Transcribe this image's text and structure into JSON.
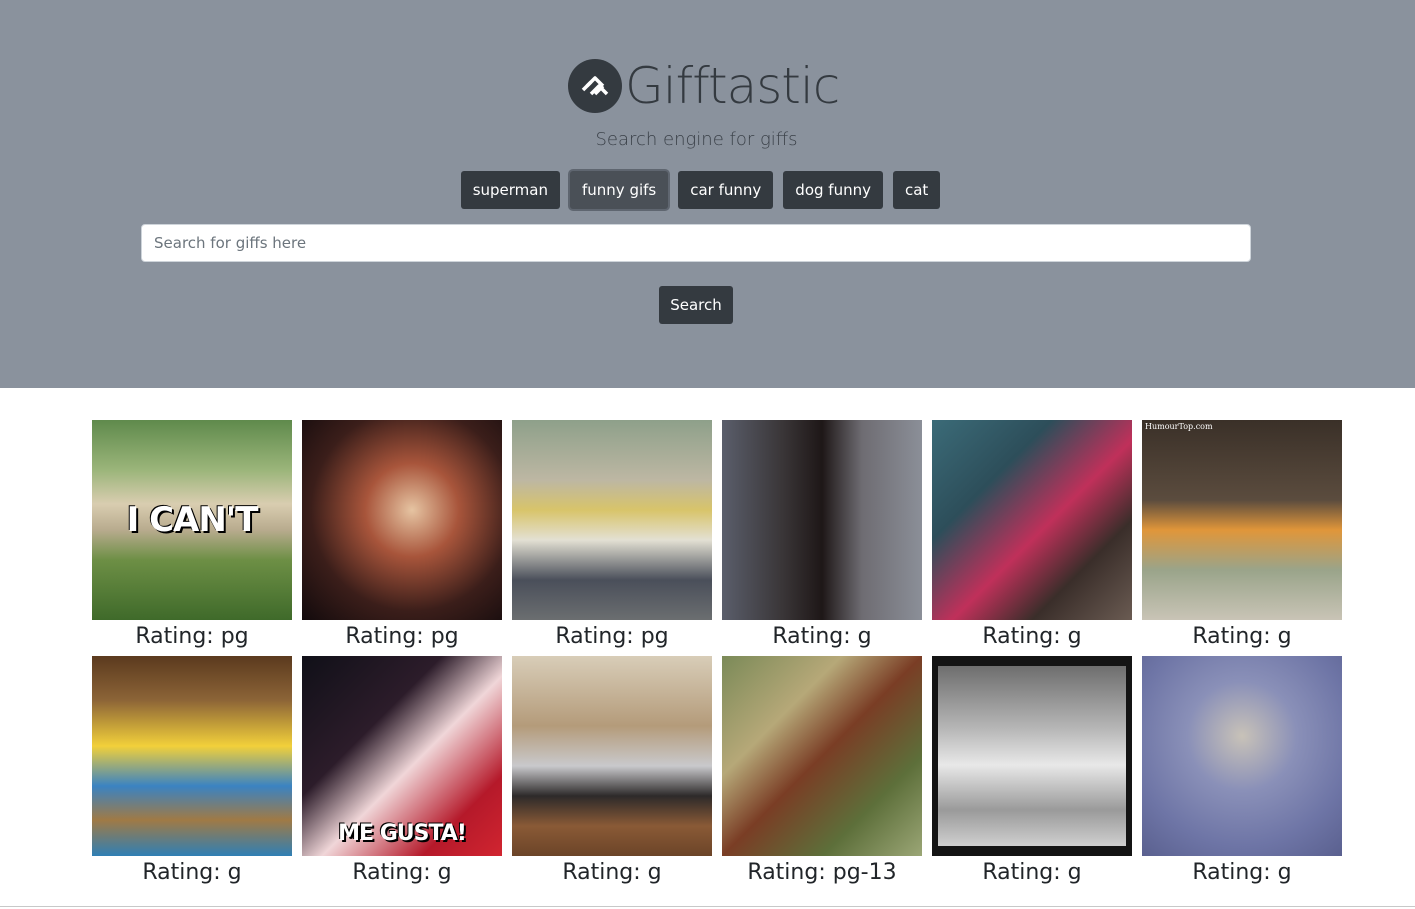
{
  "header": {
    "title": "Gifftastic",
    "tagline": "Search engine for giffs",
    "logo_icon": "gifftastic-logo-icon"
  },
  "topics": [
    {
      "label": "superman",
      "active": false
    },
    {
      "label": "funny gifs",
      "active": true
    },
    {
      "label": "car funny",
      "active": false
    },
    {
      "label": "dog funny",
      "active": false
    },
    {
      "label": "cat",
      "active": false
    }
  ],
  "search": {
    "placeholder": "Search for giffs here",
    "value": "",
    "button_label": "Search"
  },
  "gifs": [
    {
      "rating": "Rating: pg",
      "caption": "I CAN'T",
      "caption_style": "large",
      "watermark": ""
    },
    {
      "rating": "Rating: pg",
      "caption": "",
      "caption_style": "",
      "watermark": ""
    },
    {
      "rating": "Rating: pg",
      "caption": "",
      "caption_style": "",
      "watermark": ""
    },
    {
      "rating": "Rating: g",
      "caption": "",
      "caption_style": "",
      "watermark": ""
    },
    {
      "rating": "Rating: g",
      "caption": "",
      "caption_style": "",
      "watermark": ""
    },
    {
      "rating": "Rating: g",
      "caption": "",
      "caption_style": "",
      "watermark": "HumourTop.com"
    },
    {
      "rating": "Rating: g",
      "caption": "",
      "caption_style": "",
      "watermark": ""
    },
    {
      "rating": "Rating: g",
      "caption": "ME GUSTA!",
      "caption_style": "small",
      "watermark": ""
    },
    {
      "rating": "Rating: g",
      "caption": "",
      "caption_style": "",
      "watermark": ""
    },
    {
      "rating": "Rating: pg-13",
      "caption": "",
      "caption_style": "",
      "watermark": ""
    },
    {
      "rating": "Rating: g",
      "caption": "",
      "caption_style": "",
      "watermark": ""
    },
    {
      "rating": "Rating: g",
      "caption": "",
      "caption_style": "",
      "watermark": ""
    }
  ],
  "colors": {
    "hero_bg": "#8a929d",
    "button_bg": "#343a40",
    "text_dark": "#212529"
  }
}
